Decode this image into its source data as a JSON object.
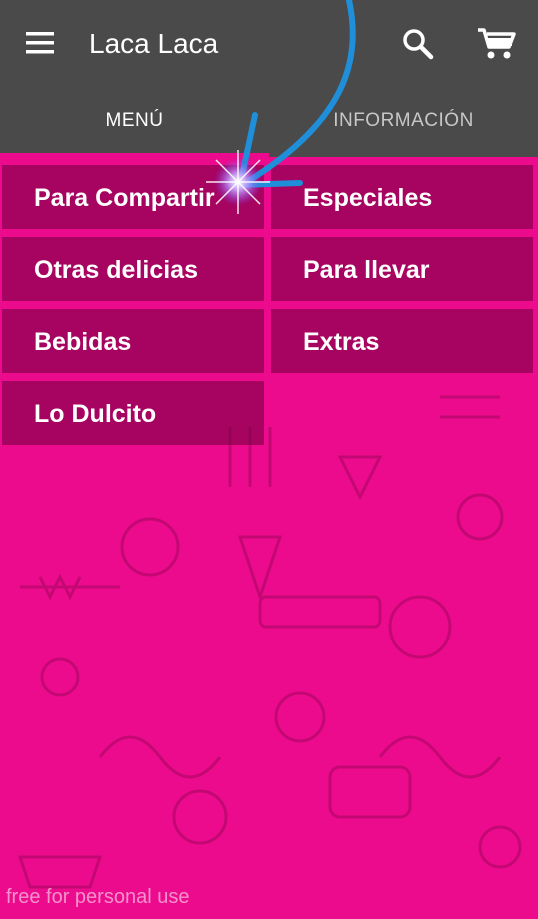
{
  "app": {
    "title": "Laca Laca",
    "icons": [
      "menu-icon",
      "search-icon",
      "cart-icon"
    ]
  },
  "tabs": [
    {
      "label": "MENÚ",
      "active": true
    },
    {
      "label": "INFORMACIÓN",
      "active": false
    }
  ],
  "menu": {
    "items": [
      {
        "label": "Para Compartir"
      },
      {
        "label": "Especiales"
      },
      {
        "label": "Otras delicias"
      },
      {
        "label": "Para llevar"
      },
      {
        "label": "Bebidas"
      },
      {
        "label": "Extras"
      },
      {
        "label": "Lo Dulcito"
      }
    ]
  },
  "watermark": "free for personal use",
  "colors": {
    "appbar": "#4a4a4a",
    "accent": "#ec0b8c",
    "tile": "#7a0a46",
    "annotation_arrow": "#1e8fd8"
  }
}
